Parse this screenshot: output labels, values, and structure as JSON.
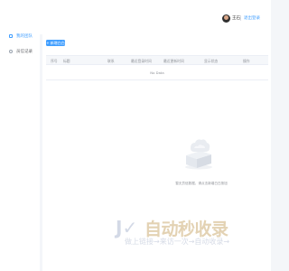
{
  "header": {
    "username": "王石",
    "logout_label": "退出登录"
  },
  "sidebar": {
    "items": [
      {
        "label": "我的团队",
        "icon": "file-icon",
        "active": true
      },
      {
        "label": "员信记录",
        "icon": "clock-icon",
        "active": false
      }
    ]
  },
  "toolbar": {
    "add_label": "+ 新增白白"
  },
  "table": {
    "columns": [
      "序号",
      "标题",
      "联系",
      "最近登录时间",
      "最近更新时间",
      "显示状态",
      "操作"
    ],
    "empty_text": "No Data"
  },
  "empty_state": {
    "message": "暂无员信数据，请点击新增白白按钮"
  },
  "watermark": {
    "title": "自动秒收录",
    "subtitle": "做上链接→来访一次→自动收录→"
  },
  "colors": {
    "primary": "#409eff",
    "background": "#f4f6f9"
  }
}
